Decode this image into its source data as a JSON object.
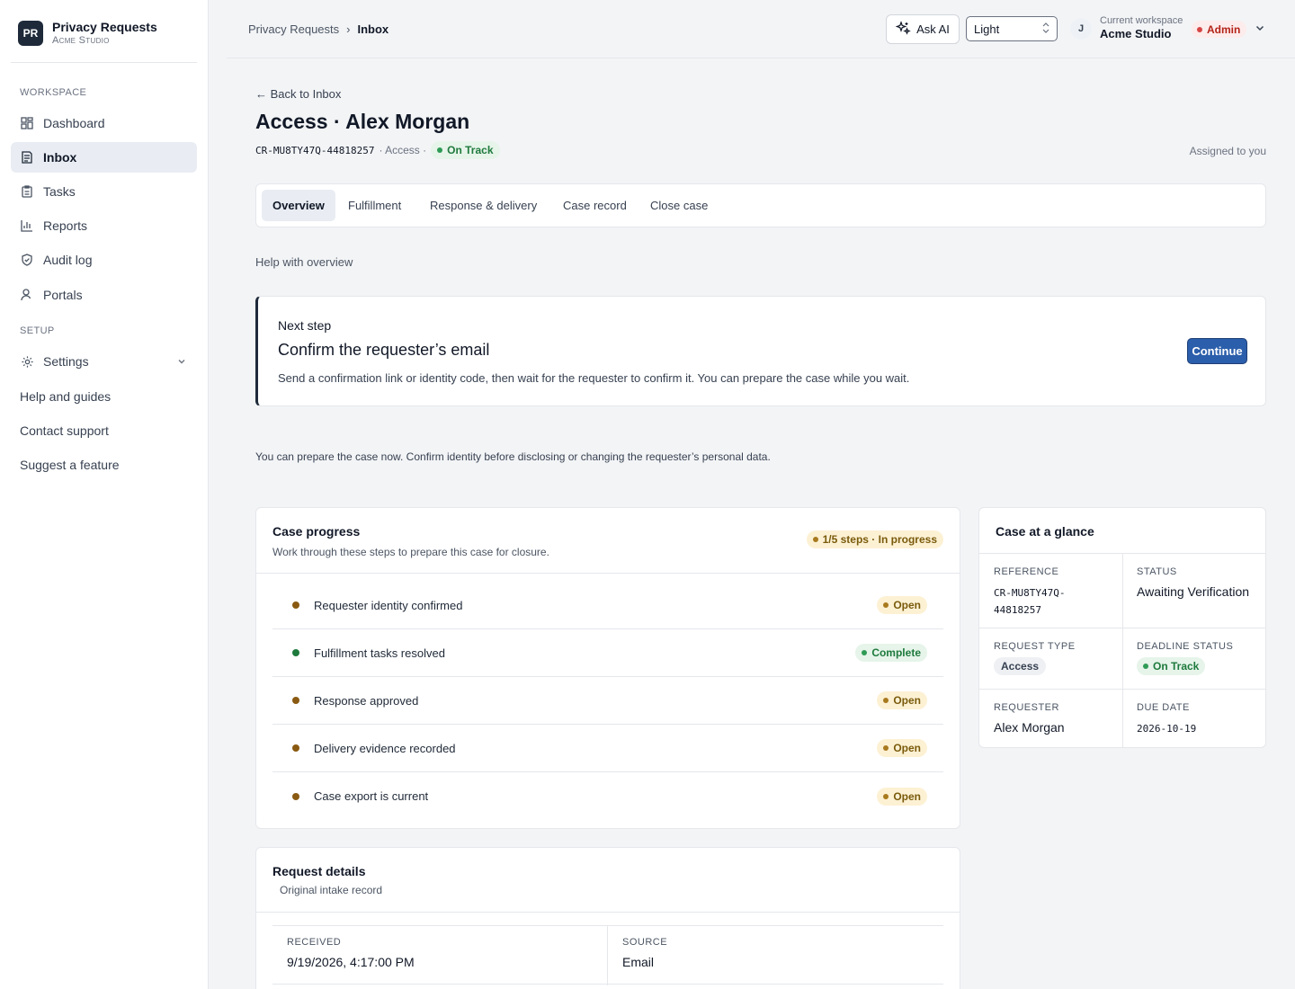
{
  "brand": {
    "logo": "PR",
    "title": "Privacy Requests",
    "subtitle": "Acme Studio"
  },
  "sidebar": {
    "workspace_label": "WORKSPACE",
    "setup_label": "SETUP",
    "items": [
      {
        "label": "Dashboard",
        "icon": "dashboard-icon"
      },
      {
        "label": "Inbox",
        "icon": "inbox-icon",
        "active": true
      },
      {
        "label": "Tasks",
        "icon": "clipboard-icon"
      },
      {
        "label": "Reports",
        "icon": "bar-chart-icon"
      },
      {
        "label": "Audit log",
        "icon": "shield-icon"
      },
      {
        "label": "Portals",
        "icon": "user-icon"
      }
    ],
    "settings": {
      "label": "Settings",
      "icon": "gear-icon"
    },
    "links": [
      "Help and guides",
      "Contact support",
      "Suggest a feature"
    ]
  },
  "topbar": {
    "breadcrumb": {
      "parent": "Privacy Requests",
      "separator": "›",
      "current": "Inbox"
    },
    "ask_ai": "Ask AI",
    "theme": "Light",
    "avatar": "J",
    "workspace_label": "Current workspace",
    "workspace_name": "Acme Studio",
    "role": "Admin"
  },
  "case": {
    "back": "← Back to Inbox",
    "title": "Access · Alex Morgan",
    "reference": "CR-MU8TY47Q-44818257",
    "type_meta": "· Access ·",
    "deadline": "On Track",
    "assigned": "Assigned to you"
  },
  "tabs": [
    "Overview",
    "Fulfillment",
    "Response & delivery",
    "Case record",
    "Close case"
  ],
  "help_text": "Help with overview",
  "next_step": {
    "label": "Next step",
    "title": "Confirm the requester’s email",
    "description": "Send a confirmation link or identity code, then wait for the requester to confirm it. You can prepare the case while you wait.",
    "button": "Continue"
  },
  "notice": "You can prepare the case now. Confirm identity before disclosing or changing the requester’s personal data.",
  "progress": {
    "title": "Case progress",
    "subtitle": "Work through these steps to prepare this case for closure.",
    "badge": "1/5 steps · In progress",
    "steps": [
      {
        "label": "Requester identity confirmed",
        "status": "Open"
      },
      {
        "label": "Fulfillment tasks resolved",
        "status": "Complete"
      },
      {
        "label": "Response approved",
        "status": "Open"
      },
      {
        "label": "Delivery evidence recorded",
        "status": "Open"
      },
      {
        "label": "Case export is current",
        "status": "Open"
      }
    ]
  },
  "glance": {
    "title": "Case at a glance",
    "reference_label": "REFERENCE",
    "reference_line1": "CR-MU8TY47Q-",
    "reference_line2": "44818257",
    "status_label": "STATUS",
    "status": "Awaiting Verification",
    "type_label": "REQUEST TYPE",
    "type": "Access",
    "deadline_label": "DEADLINE STATUS",
    "deadline": "On Track",
    "requester_label": "REQUESTER",
    "requester": "Alex Morgan",
    "due_label": "DUE DATE",
    "due": "2026-10-19"
  },
  "details": {
    "title": "Request details",
    "subtitle": "Original intake record",
    "received_label": "RECEIVED",
    "received": "9/19/2026, 4:17:00 PM",
    "source_label": "SOURCE",
    "source": "Email"
  },
  "colors": {
    "brand": "#1e2a3a",
    "accent": "#2b5eab",
    "open": "#8a5a12",
    "complete": "#1e7a3c",
    "admin": "#d64545"
  }
}
